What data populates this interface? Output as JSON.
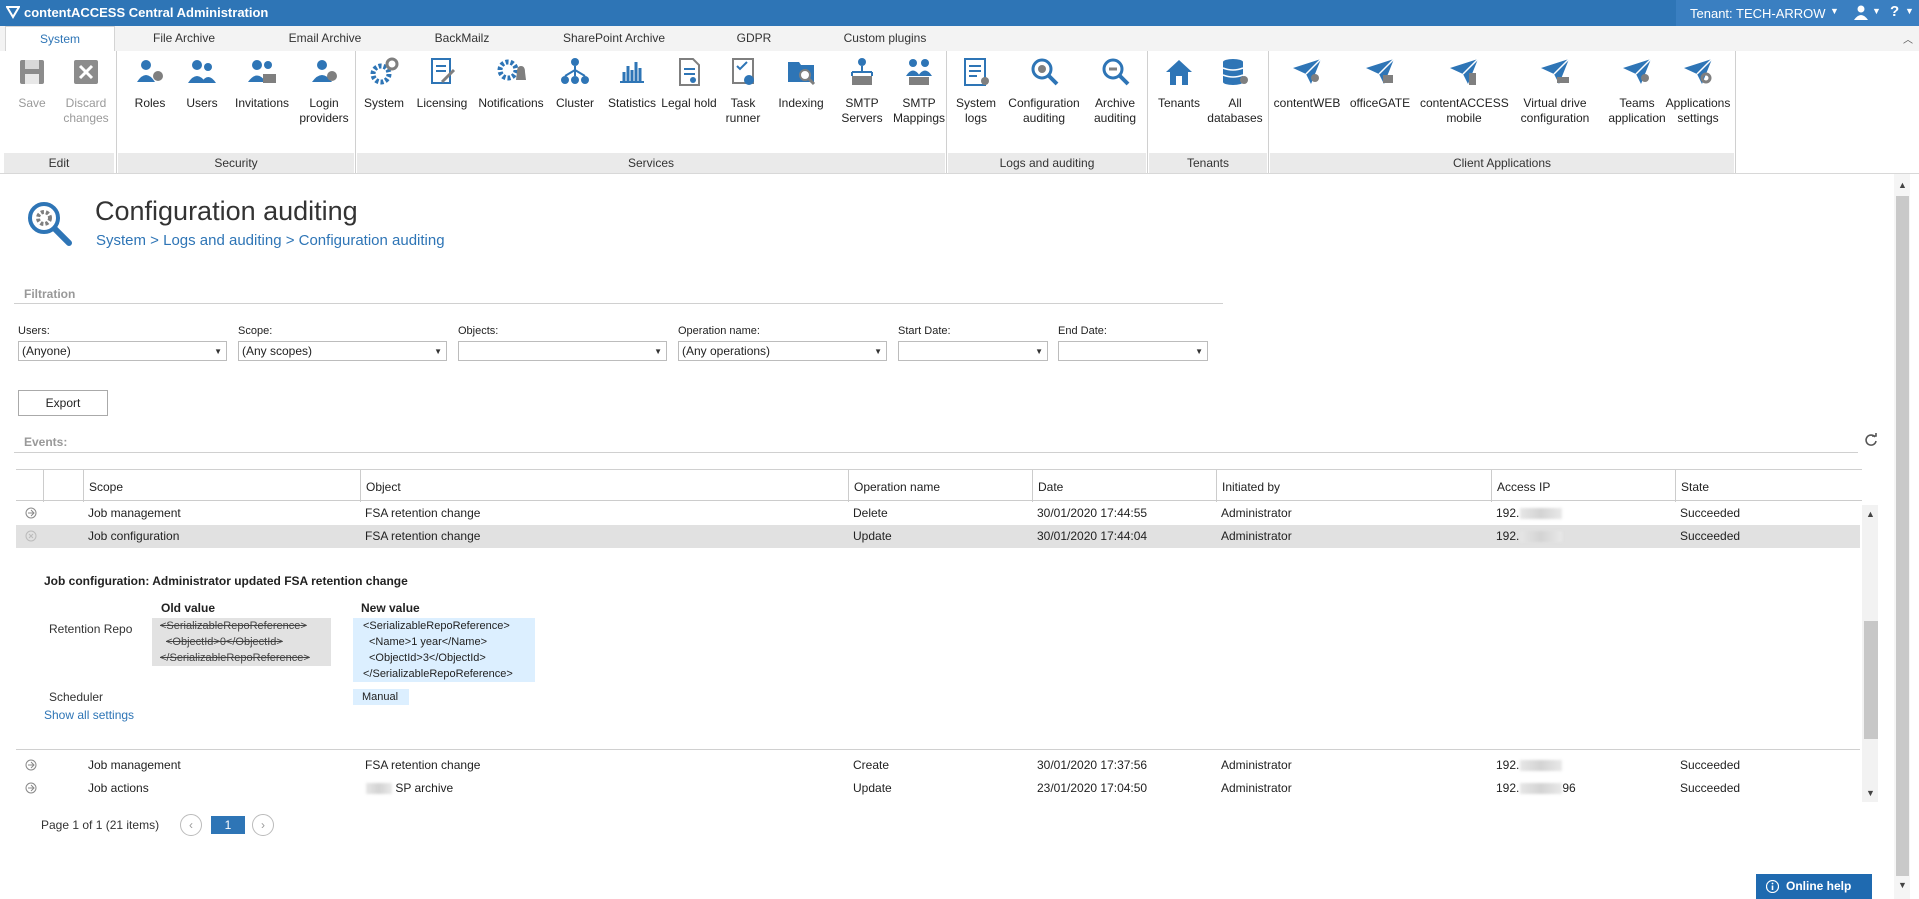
{
  "app": {
    "title": "contentACCESS Central Administration",
    "tenant": "Tenant: TECH-ARROW",
    "help": "?",
    "accent": "#2e75b6"
  },
  "tabs": [
    "System",
    "File Archive",
    "Email Archive",
    "BackMailz",
    "SharePoint Archive",
    "GDPR",
    "Custom plugins"
  ],
  "ribbon": {
    "groups": {
      "edit": "Edit",
      "security": "Security",
      "services": "Services",
      "logs": "Logs and auditing",
      "tenants": "Tenants",
      "client": "Client Applications"
    },
    "buttons": {
      "save": "Save",
      "discard": "Discard changes",
      "roles": "Roles",
      "users": "Users",
      "invitations": "Invitations",
      "login_providers": "Login providers",
      "system": "System",
      "licensing": "Licensing",
      "notifications": "Notifications",
      "cluster": "Cluster",
      "statistics": "Statistics",
      "legal_hold": "Legal hold",
      "task_runner": "Task runner",
      "indexing": "Indexing",
      "smtp_servers": "SMTP Servers",
      "smtp_mappings": "SMTP Mappings",
      "system_logs": "System logs",
      "config_auditing": "Configuration auditing",
      "archive_auditing": "Archive auditing",
      "tenants": "Tenants",
      "all_databases": "All databases",
      "contentweb": "contentWEB",
      "officegate": "officeGATE",
      "ca_mobile": "contentACCESS mobile",
      "virtual_drive": "Virtual drive configuration",
      "teams": "Teams application",
      "app_settings": "Applications settings"
    }
  },
  "page": {
    "title": "Configuration auditing",
    "breadcrumb": "System > Logs and auditing > Configuration auditing"
  },
  "filtration": {
    "section_label": "Filtration",
    "users_label": "Users:",
    "users_value": "(Anyone)",
    "scope_label": "Scope:",
    "scope_value": "(Any scopes)",
    "objects_label": "Objects:",
    "objects_value": "",
    "operation_label": "Operation name:",
    "operation_value": "(Any operations)",
    "start_label": "Start Date:",
    "start_value": "",
    "end_label": "End Date:",
    "end_value": "",
    "export": "Export"
  },
  "events": {
    "section_label": "Events:",
    "columns": [
      "Scope",
      "Object",
      "Operation name",
      "Date",
      "Initiated by",
      "Access IP",
      "State"
    ],
    "rows": [
      {
        "scope": "Job management",
        "object": "FSA retention change",
        "operation": "Delete",
        "date": "30/01/2020 17:44:55",
        "by": "Administrator",
        "ip": "192.",
        "state": "Succeeded"
      },
      {
        "scope": "Job configuration",
        "object": "FSA retention change",
        "operation": "Update",
        "date": "30/01/2020 17:44:04",
        "by": "Administrator",
        "ip": "192.",
        "state": "Succeeded"
      },
      {
        "scope": "Job management",
        "object": "FSA retention change",
        "operation": "Create",
        "date": "30/01/2020 17:37:56",
        "by": "Administrator",
        "ip": "192.",
        "state": "Succeeded"
      },
      {
        "scope": "Job actions",
        "object": "SP archive",
        "operation": "Update",
        "date": "23/01/2020 17:04:50",
        "by": "Administrator",
        "ip": "192.",
        "ip_tail": "96",
        "state": "Succeeded"
      }
    ],
    "detail": {
      "title": "Job configuration: Administrator updated FSA retention change",
      "old_header": "Old value",
      "new_header": "New value",
      "field1": "Retention Repo",
      "old_lines": [
        "<SerializableRepoReference>",
        "  <ObjectId>0</ObjectId>",
        "</SerializableRepoReference>"
      ],
      "new_lines": [
        "<SerializableRepoReference>",
        "  <Name>1 year</Name>",
        "  <ObjectId>3</ObjectId>",
        "</SerializableRepoReference>"
      ],
      "field2": "Scheduler",
      "new_scheduler": "Manual",
      "show_all": "Show all settings"
    }
  },
  "pager": {
    "summary": "Page 1 of 1 (21 items)",
    "current": "1"
  },
  "online_help": "Online help"
}
